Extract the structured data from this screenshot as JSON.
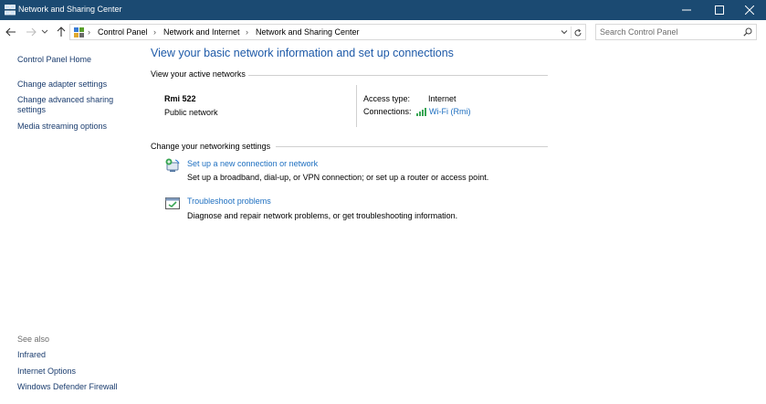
{
  "window": {
    "title": "Network and Sharing Center",
    "icon": "network-sharing-icon"
  },
  "address": {
    "crumbs": [
      "Control Panel",
      "Network and Internet",
      "Network and Sharing Center"
    ],
    "search_placeholder": "Search Control Panel"
  },
  "left_pane": {
    "home": "Control Panel Home",
    "links": [
      "Change adapter settings",
      "Change advanced sharing",
      "settings",
      "Media streaming options"
    ],
    "see_also_label": "See also",
    "see_also": [
      "Infrared",
      "Internet Options",
      "Windows Defender Firewall"
    ]
  },
  "main": {
    "heading": "View your basic network information and set up connections",
    "active_label": "View your active networks",
    "network": {
      "name": "Rmi 522",
      "category": "Public network",
      "access_type_label": "Access type:",
      "access_type": "Internet",
      "connections_label": "Connections:",
      "connection": "Wi-Fi (Rmi)"
    },
    "change_label": "Change your networking settings",
    "tasks": [
      {
        "title": "Set up a new connection or network",
        "desc": "Set up a broadband, dial-up, or VPN connection; or set up a router or access point."
      },
      {
        "title": "Troubleshoot problems",
        "desc": "Diagnose and repair network problems, or get troubleshooting information."
      }
    ]
  },
  "colors": {
    "titlebar": "#1b4a72",
    "heading": "#1e5aa8",
    "link": "#1e6fc0"
  }
}
